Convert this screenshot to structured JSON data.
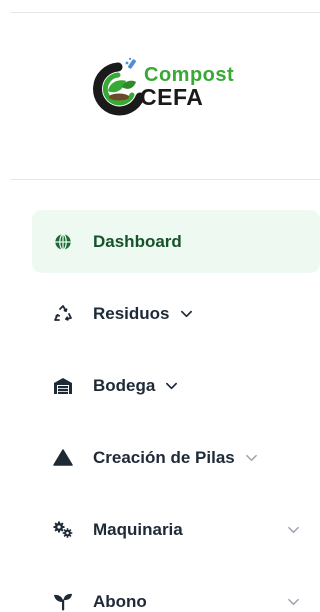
{
  "brand": {
    "line1": "Compost",
    "line2": "CEFA",
    "colors": {
      "green": "#39a935",
      "dark": "#1a1a1a"
    }
  },
  "nav": {
    "items": [
      {
        "label": "Dashboard",
        "icon": "globe-icon",
        "active": true
      },
      {
        "label": "Residuos",
        "icon": "recycle-icon",
        "has_dropdown": true
      },
      {
        "label": "Bodega",
        "icon": "warehouse-icon",
        "has_dropdown": true
      },
      {
        "label": "Creación de Pilas",
        "icon": "mountain-icon",
        "has_dropdown": true
      },
      {
        "label": "Maquinaria",
        "icon": "gears-icon",
        "has_dropdown": true
      },
      {
        "label": "Abono",
        "icon": "seedling-icon",
        "has_dropdown": true
      }
    ]
  },
  "colors": {
    "active_bg": "#eefaf1",
    "active_text": "#16532c",
    "globe": "#1a6a35"
  }
}
